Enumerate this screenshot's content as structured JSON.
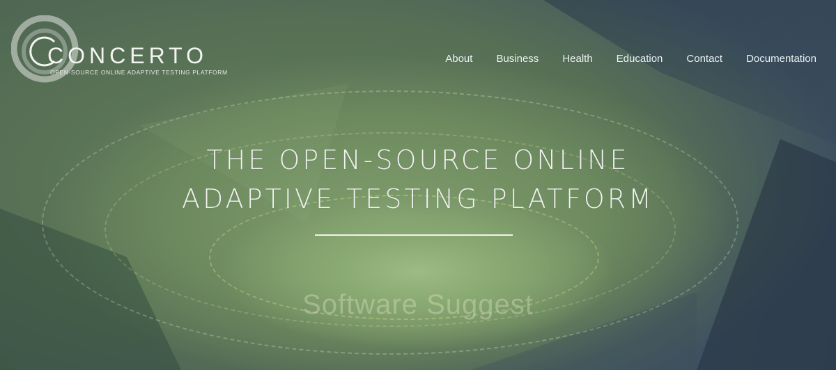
{
  "brand": {
    "name": "CONCERTO",
    "tagline": "OPEN-SOURCE ONLINE ADAPTIVE TESTING PLATFORM"
  },
  "nav": {
    "items": [
      "About",
      "Business",
      "Health",
      "Education",
      "Contact",
      "Documentation"
    ]
  },
  "hero": {
    "headline_line1": "THE OPEN-SOURCE ONLINE",
    "headline_line2": "ADAPTIVE TESTING PLATFORM",
    "sub_text": "Software Suggest"
  },
  "colors": {
    "text": "#f0f2f0",
    "background": "#3c4e5c",
    "accent_green": "#8aaa73"
  },
  "icons": {
    "logo": "concerto-ring-logo"
  }
}
